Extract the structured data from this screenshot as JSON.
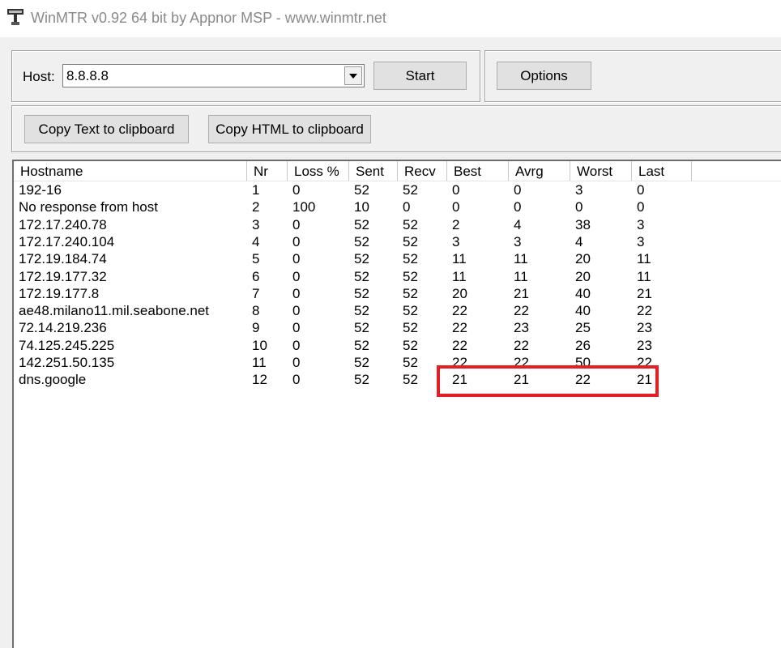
{
  "window": {
    "title": "WinMTR v0.92 64 bit by Appnor MSP - www.winmtr.net",
    "icon": "winmtr-app-icon"
  },
  "controls": {
    "host_label": "Host:",
    "host_value": "8.8.8.8",
    "start_label": "Start",
    "options_label": "Options",
    "copy_text_label": "Copy Text to clipboard",
    "copy_html_label": "Copy HTML to clipboard"
  },
  "table": {
    "columns": [
      "Hostname",
      "Nr",
      "Loss %",
      "Sent",
      "Recv",
      "Best",
      "Avrg",
      "Worst",
      "Last"
    ],
    "rows": [
      [
        "192-16",
        "1",
        "0",
        "52",
        "52",
        "0",
        "0",
        "3",
        "0"
      ],
      [
        "No response from host",
        "2",
        "100",
        "10",
        "0",
        "0",
        "0",
        "0",
        "0"
      ],
      [
        "172.17.240.78",
        "3",
        "0",
        "52",
        "52",
        "2",
        "4",
        "38",
        "3"
      ],
      [
        "172.17.240.104",
        "4",
        "0",
        "52",
        "52",
        "3",
        "3",
        "4",
        "3"
      ],
      [
        "172.19.184.74",
        "5",
        "0",
        "52",
        "52",
        "11",
        "11",
        "20",
        "11"
      ],
      [
        "172.19.177.32",
        "6",
        "0",
        "52",
        "52",
        "11",
        "11",
        "20",
        "11"
      ],
      [
        "172.19.177.8",
        "7",
        "0",
        "52",
        "52",
        "20",
        "21",
        "40",
        "21"
      ],
      [
        "ae48.milano11.mil.seabone.net",
        "8",
        "0",
        "52",
        "52",
        "22",
        "22",
        "40",
        "22"
      ],
      [
        "72.14.219.236",
        "9",
        "0",
        "52",
        "52",
        "22",
        "23",
        "25",
        "23"
      ],
      [
        "74.125.245.225",
        "10",
        "0",
        "52",
        "52",
        "22",
        "22",
        "26",
        "23"
      ],
      [
        "142.251.50.135",
        "11",
        "0",
        "52",
        "52",
        "22",
        "22",
        "50",
        "22"
      ],
      [
        "dns.google",
        "12",
        "0",
        "52",
        "52",
        "21",
        "21",
        "22",
        "21"
      ]
    ]
  },
  "annotation": {
    "highlight_color": "#e31e24",
    "highlight_row": 12
  }
}
